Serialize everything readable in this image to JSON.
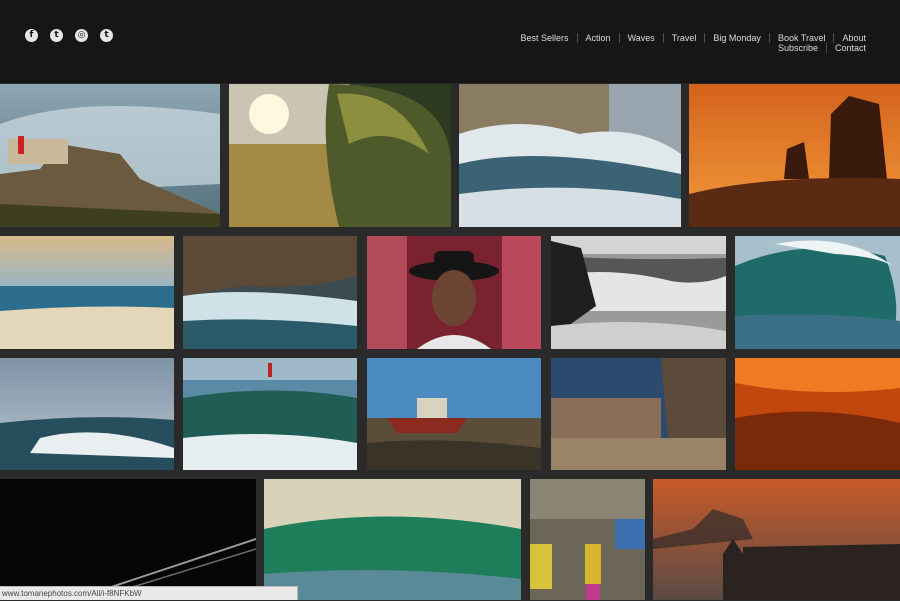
{
  "social_icons": [
    {
      "name": "facebook-icon",
      "glyph": "f"
    },
    {
      "name": "twitter-icon",
      "glyph": "t"
    },
    {
      "name": "instagram-icon",
      "glyph": "◎"
    },
    {
      "name": "tumblr-icon",
      "glyph": "t"
    }
  ],
  "nav": {
    "row1": [
      "Best Sellers",
      "Action",
      "Waves",
      "Travel",
      "Big Monday",
      "Book Travel",
      "About"
    ],
    "row2": [
      "Subscribe",
      "Contact"
    ]
  },
  "status_url": "www.tomanephotos.com/All/i-f8NFKbW",
  "colors": {
    "header_bg": "#161616",
    "grid_bg": "#2a2a2a",
    "nav_text": "#dcdcdc"
  }
}
